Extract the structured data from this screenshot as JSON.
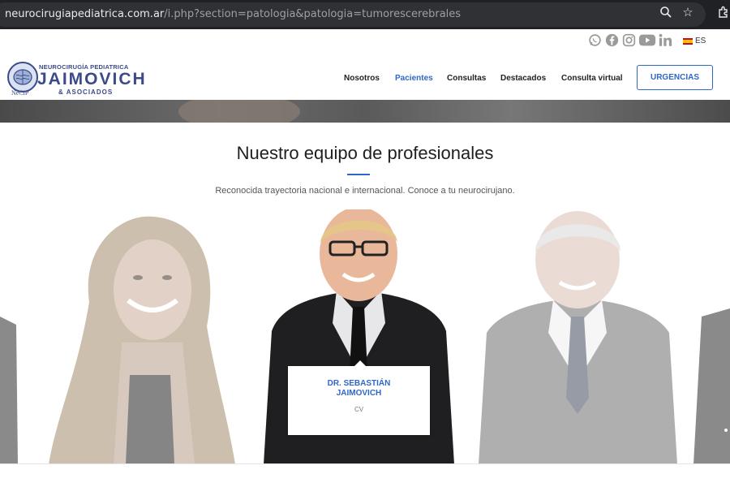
{
  "browser": {
    "url_host": "neurocirugiapediatrica.com.ar",
    "url_path": "/i.php?section=patologia&patologia=tumorescerebrales",
    "icons": [
      "zoom-icon",
      "star-icon",
      "extensions-icon"
    ]
  },
  "topbar": {
    "social_icons": [
      "whatsapp-icon",
      "facebook-icon",
      "instagram-icon",
      "youtube-icon",
      "linkedin-icon"
    ],
    "lang": "ES"
  },
  "logo": {
    "top": "NEUROCIRUGÍA PEDIATRICA",
    "main": "JAIMOVICH",
    "sub": "& ASOCIADOS",
    "badge": "NeCiP"
  },
  "nav": {
    "items": [
      {
        "label": "Nosotros"
      },
      {
        "label": "Pacientes",
        "active": true
      },
      {
        "label": "Consultas"
      },
      {
        "label": "Destacados"
      },
      {
        "label": "Consulta virtual"
      }
    ],
    "urgencias": "URGENCIAS"
  },
  "section": {
    "title": "Nuestro equipo de profesionales",
    "subtitle": "Reconocida trayectoria nacional e internacional. Conoce a tu neurocirujano."
  },
  "featured": {
    "name_line1": "DR. SEBASTIÁN",
    "name_line2": "JAIMOVICH",
    "cv": "CV"
  },
  "colors": {
    "accent": "#2f67c7",
    "brand": "#3b4a8a"
  }
}
